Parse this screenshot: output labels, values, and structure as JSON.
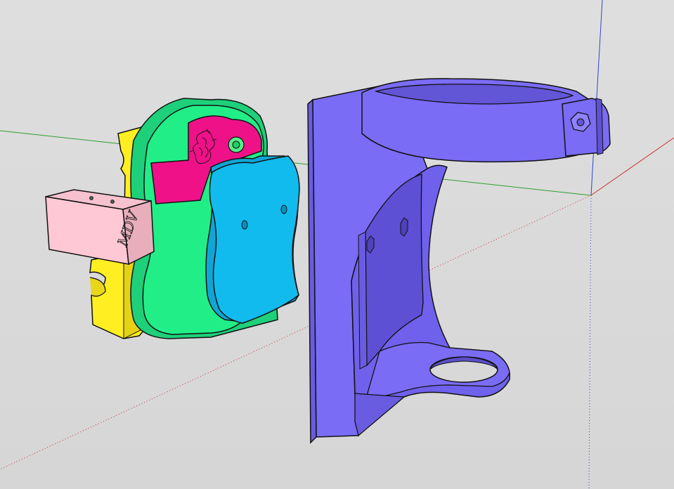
{
  "app": {
    "view": "3d-model-viewport",
    "background_color": "#dcdcdc"
  },
  "axes": {
    "red_color": "#cc3333",
    "green_color": "#2e9e2e",
    "blue_color": "#3344cc"
  },
  "model_parts": [
    {
      "name": "yellow-clamp",
      "color": "#ffee22"
    },
    {
      "name": "green-body",
      "color": "#22ee88"
    },
    {
      "name": "magenta-plate",
      "color": "#ee1188"
    },
    {
      "name": "cyan-cover",
      "color": "#11bbee"
    },
    {
      "name": "pink-block",
      "color": "#ffc8d4"
    },
    {
      "name": "purple-bracket",
      "color": "#7b6cf5"
    }
  ],
  "pink_block_engraving": "MDV",
  "magenta_plate_emblem": "ornament"
}
